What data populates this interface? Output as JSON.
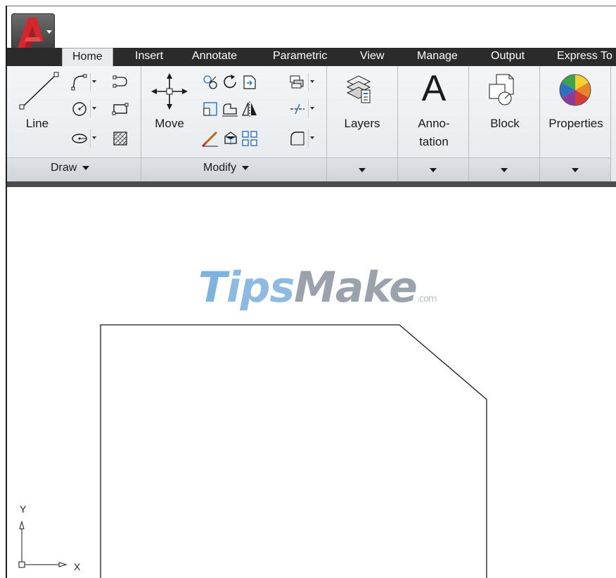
{
  "tabs": [
    {
      "label": "Home",
      "active": true
    },
    {
      "label": "Insert"
    },
    {
      "label": "Annotate"
    },
    {
      "label": "Parametric"
    },
    {
      "label": "View"
    },
    {
      "label": "Manage"
    },
    {
      "label": "Output"
    },
    {
      "label": "Express To"
    }
  ],
  "ribbon": {
    "draw": {
      "title": "Draw",
      "line_label": "Line"
    },
    "modify": {
      "title": "Modify",
      "move_label": "Move"
    },
    "layers_label": "Layers",
    "annotation_label_1": "Anno-",
    "annotation_label_2": "tation",
    "block_label": "Block",
    "properties_label": "Properties"
  },
  "canvas": {
    "watermark": {
      "t": "T",
      "ips": "ips",
      "make": "Make",
      "com": ".com"
    },
    "ucs": {
      "x_label": "X",
      "y_label": "Y"
    }
  },
  "colors": {
    "tab_strip": "#2b2b2b",
    "ribbon_bg": "#e9ecef",
    "app_red": "#c8262c"
  }
}
